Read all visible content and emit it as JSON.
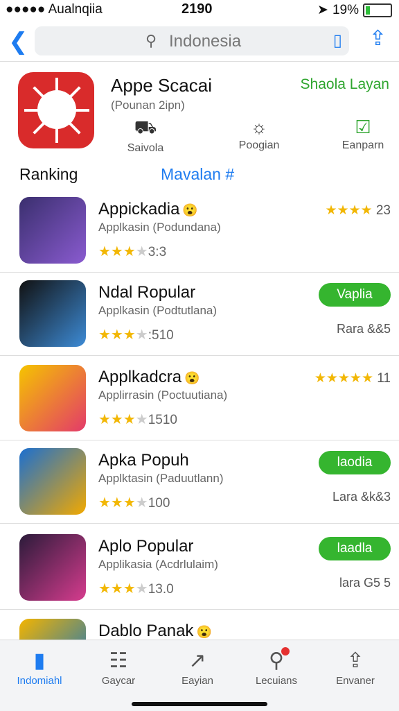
{
  "status": {
    "carrier": "●●●●● Aualnqiia",
    "time": "2190",
    "battery": "19%",
    "battery_level": 0.19
  },
  "nav": {
    "search_text": "Indonesia"
  },
  "featured": {
    "title": "Appe Scacai",
    "subtitle": "(Pounan 2ipn)",
    "link": "Shaola Layan",
    "options": [
      {
        "label": "Saivola",
        "icon": "car-icon"
      },
      {
        "label": "Poogian",
        "icon": "sun-icon"
      },
      {
        "label": "Eanparn",
        "icon": "checkbox-icon"
      }
    ]
  },
  "ranking": {
    "header": "Ranking",
    "mid": "Mavalan #"
  },
  "apps": [
    {
      "title": "Appickadia",
      "emoji": "😮",
      "subtitle": "Applkasin (Podundana)",
      "rating": "3:3",
      "right_stars": "★★★★",
      "right_num": "23",
      "colors": [
        "#3a2f6e",
        "#8a5bd0"
      ]
    },
    {
      "title": "Ndal Ropular",
      "subtitle": "Applkasin (Podtutlana)",
      "rating": ":510",
      "button": "Vaplia",
      "meta": "Rara &&5",
      "colors": [
        "#111",
        "#3d8bd6"
      ]
    },
    {
      "title": "Applkadcra",
      "emoji": "😮",
      "subtitle": "Applirrasin (Poctuutiana)",
      "rating": "1510",
      "right_stars": "★★★★★",
      "right_num": "11",
      "colors": [
        "#f5c400",
        "#e33a6a"
      ]
    },
    {
      "title": "Apka Popuh",
      "subtitle": "Applktasin (Paduutlann)",
      "rating": "100",
      "button": "laodia",
      "meta": "Lara &k&3",
      "colors": [
        "#1b6fd0",
        "#f2a900"
      ]
    },
    {
      "title": "Aplo Popular",
      "subtitle": "Applikasia (Acdrlulaim)",
      "rating": "13.0",
      "button": "laadla",
      "meta": "lara G5 5",
      "colors": [
        "#2b1b3a",
        "#d63c8e"
      ]
    },
    {
      "title": "Dablo Panak",
      "emoji": "😮",
      "subtitle": "",
      "rating": "",
      "colors": [
        "#f3b400",
        "#0a72c9"
      ]
    }
  ],
  "tabs": [
    {
      "label": "Indomiahl",
      "icon": "home-icon",
      "active": true
    },
    {
      "label": "Gaycar",
      "icon": "chat-icon"
    },
    {
      "label": "Eayian",
      "icon": "trend-icon"
    },
    {
      "label": "Lecuians",
      "icon": "search-icon",
      "badge": true
    },
    {
      "label": "Envaner",
      "icon": "share-icon"
    }
  ]
}
